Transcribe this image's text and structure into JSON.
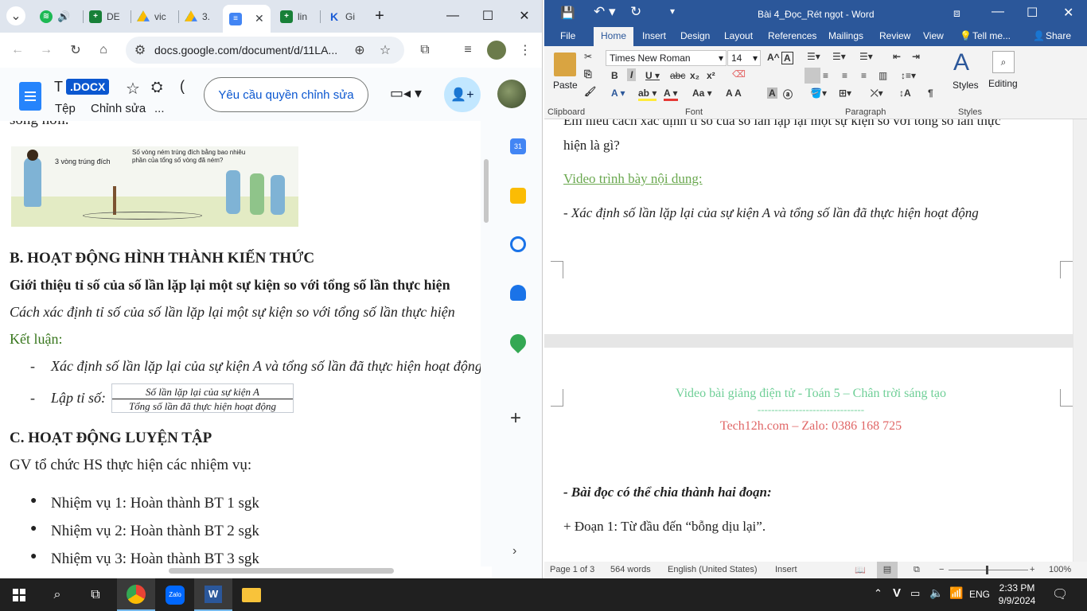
{
  "chrome": {
    "tabs": [
      {
        "label": "",
        "favicon": "spotify-icon"
      },
      {
        "label": "DE",
        "favicon": "sheets-icon"
      },
      {
        "label": "vic",
        "favicon": "drive-icon"
      },
      {
        "label": "3.",
        "favicon": "drive-icon"
      },
      {
        "label": "",
        "favicon": "docs-icon",
        "active": true
      },
      {
        "label": "lin",
        "favicon": "sheets-icon"
      },
      {
        "label": "Gi",
        "favicon": "k-icon"
      }
    ],
    "url": "docs.google.com/document/d/11LA...",
    "docs": {
      "title_initial": "T",
      "badge": ".DOCX",
      "menu_file": "Tệp",
      "menu_edit": "Chỉnh sửa",
      "menu_more": "...",
      "request_edit": "Yêu cầu quyền chỉnh sửa",
      "top_fragment": "sống hơn.",
      "illustration": {
        "bubble_left": "3 vòng trúng đích",
        "bubble_right": "Số vòng ném trúng đích bằng bao nhiêu phần của tổng số vòng đã ném?"
      },
      "heading_b": "B. HOẠT ĐỘNG HÌNH THÀNH KIẾN THỨC",
      "intro_bold": "Giới thiệu tỉ số của số lần lặp lại một sự kiện so với tổng số lần thực hiện",
      "intro_italic": "Cách xác định tỉ số của số lần lặp lại một sự kiện so với tổng số lần thực hiện",
      "conclusion": "Kết luận:",
      "bullet_dash": "-",
      "dash1": "Xác định số lần lặp lại của sự kiện A và tổng số lần đã thực hiện hoạt động",
      "dash2": "Lập tỉ số:",
      "fraction_num": "Số lần lặp lại của sự kiện A",
      "fraction_den": "Tổng số lần đã thực hiện hoạt động",
      "heading_c": "C. HOẠT ĐỘNG LUYỆN TẬP",
      "gv_line": "GV tổ chức HS thực hiện các nhiệm vụ:",
      "tasks": [
        "Nhiệm vụ 1: Hoàn thành BT 1 sgk",
        "Nhiệm vụ 2: Hoàn thành BT 2 sgk",
        "Nhiệm vụ 3: Hoàn thành BT 3 sgk"
      ]
    }
  },
  "word": {
    "title": "Bài 4_Đọc_Rét ngọt - Word",
    "tabs": [
      "File",
      "Home",
      "Insert",
      "Design",
      "Layout",
      "References",
      "Mailings",
      "Review",
      "View"
    ],
    "tell_me": "Tell me...",
    "share": "Share",
    "font_name": "Times New Roman",
    "font_size": "14",
    "groups": {
      "clipboard": "Clipboard",
      "font": "Font",
      "paragraph": "Paragraph",
      "styles": "Styles"
    },
    "paste": "Paste",
    "styles_btn": "Styles",
    "editing_btn": "Editing",
    "page1": {
      "cut_line": "Em hiểu cách xác định tỉ số của số lần lặp lại một sự kiện so với tổng số lần thực",
      "line2": "hiện là gì?",
      "video_heading": "Video trình bày nội dung:",
      "italic_line": "- Xác định số lần lặp lại của sự kiện A và tổng số lần đã thực hiện hoạt động"
    },
    "page2": {
      "header_line1": "Video bài giảng điện tử - Toán 5 – Chân trời sáng tạo",
      "header_dashes": "-------------------------------",
      "header_line2": "Tech12h.com – Zalo: 0386 168 725",
      "bold_line": "- Bài đọc có thể chia thành hai đoạn:",
      "para_line": "+ Đoạn 1: Từ đầu đến “bỗng dịu lại”."
    },
    "status": {
      "page": "Page 1 of 3",
      "words": "564 words",
      "language": "English (United States)",
      "mode": "Insert",
      "zoom": "100%"
    }
  },
  "taskbar": {
    "language": "ENG",
    "time": "2:33 PM",
    "date": "9/9/2024",
    "zalo": "Zalo"
  },
  "colors": {
    "word_blue": "#2b579a",
    "docs_blue": "#0b57d0",
    "green_text": "#6aa84f",
    "pink_text": "#e06666",
    "teal_text": "#6fcf97"
  }
}
